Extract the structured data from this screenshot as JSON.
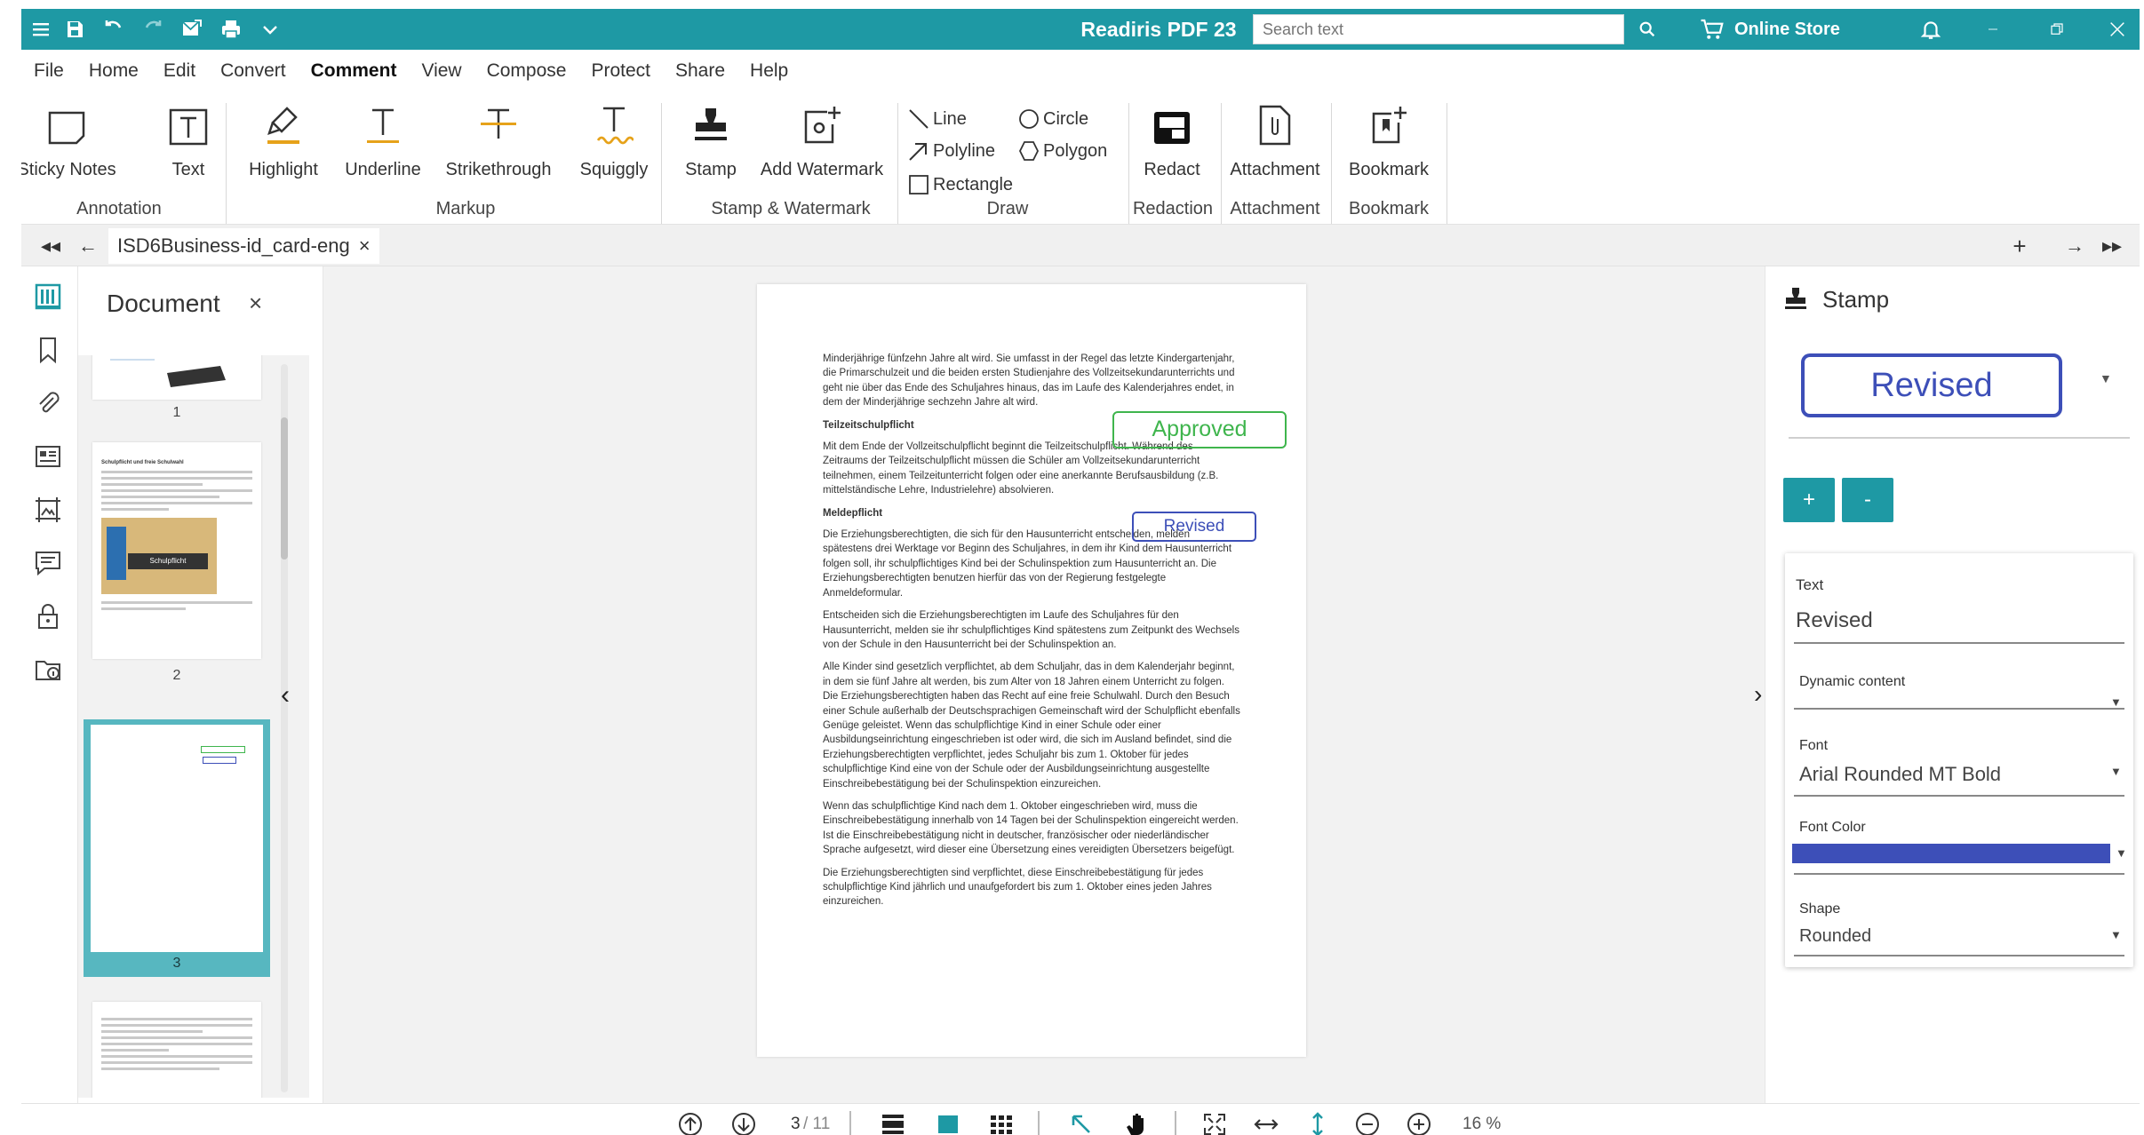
{
  "titlebar": {
    "app_title": "Readiris PDF 23",
    "search_placeholder": "Search text",
    "store_label": "Online Store",
    "accent_color": "#1e99a4"
  },
  "menu": [
    "File",
    "Home",
    "Edit",
    "Convert",
    "Comment",
    "View",
    "Compose",
    "Protect",
    "Share",
    "Help"
  ],
  "menu_active": "Comment",
  "ribbon": {
    "sticky_notes": "Sticky Notes",
    "text": "Text",
    "highlight": "Highlight",
    "underline": "Underline",
    "strikethrough": "Strikethrough",
    "squiggly": "Squiggly",
    "stamp": "Stamp",
    "add_watermark": "Add Watermark",
    "line": "Line",
    "circle": "Circle",
    "polyline": "Polyline",
    "polygon": "Polygon",
    "rectangle": "Rectangle",
    "redact": "Redact",
    "attachment": "Attachment",
    "bookmark": "Bookmark",
    "groups": {
      "annotation": "Annotation",
      "markup": "Markup",
      "stamp_watermark": "Stamp & Watermark",
      "draw": "Draw",
      "redaction": "Redaction",
      "attachment": "Attachment",
      "bookmark": "Bookmark"
    }
  },
  "tab": {
    "label": "ISD6Business-id_card-eng",
    "close": "×"
  },
  "left_panel": {
    "title": "Document",
    "close": "×",
    "thumb_labels": [
      "1",
      "2",
      "3"
    ],
    "thumb2_title": "Schulpflicht und freie Schulwahl",
    "thumb2_image_label": "Schulpflicht"
  },
  "document": {
    "para1": "Minderjährige fünfzehn Jahre alt wird. Sie umfasst in der Regel das letzte Kindergartenjahr, die Primarschulzeit und die beiden ersten Studienjahre des Vollzeitsekundarunterrichts und geht nie über das Ende des Schuljahres hinaus, das im Laufe des Kalenderjahres endet, in dem der Minderjährige sechzehn Jahre alt wird.",
    "heading1": "Teilzeitschulpflicht",
    "para2": "Mit dem Ende der Vollzeitschulpflicht beginnt die Teilzeitschulpflicht. Während des Zeitraums der Teilzeitschulpflicht müssen die Schüler am Vollzeitsekundarunterricht teilnehmen, einem Teilzeitunterricht folgen oder eine anerkannte Berufsausbildung (z.B. mittelständische Lehre, Industrielehre) absolvieren.",
    "heading2": "Meldepflicht",
    "para3": "Die Erziehungsberechtigten, die sich für den Hausunterricht entscheiden, melden spätestens drei Werktage vor Beginn des Schuljahres, in dem ihr Kind dem Hausunterricht folgen soll, ihr schulpflichtiges Kind bei der Schulinspektion zum Hausunterricht an. Die Erziehungsberechtigten benutzen hierfür das von der Regierung festgelegte Anmeldeformular.",
    "para4": "Entscheiden sich die Erziehungsberechtigten im Laufe des Schuljahres für den Hausunterricht, melden sie ihr schulpflichtiges Kind spätestens zum Zeitpunkt des Wechsels von der Schule in den Hausunterricht bei der Schulinspektion an.",
    "para5": "Alle Kinder sind gesetzlich verpflichtet, ab dem Schuljahr, das in dem Kalenderjahr beginnt, in dem sie fünf Jahre alt werden, bis zum Alter von 18 Jahren einem Unterricht zu folgen. Die Erziehungsberechtigten haben das Recht auf eine freie Schulwahl. Durch den Besuch einer Schule außerhalb der Deutschsprachigen Gemeinschaft wird der Schulpflicht ebenfalls Genüge geleistet. Wenn das schulpflichtige Kind in einer Schule oder einer Ausbildungseinrichtung eingeschrieben ist oder wird, die sich im Ausland befindet, sind die Erziehungsberechtigten verpflichtet, jedes Schuljahr bis zum 1. Oktober für jedes schulpflichtige Kind eine von der Schule oder der Ausbildungseinrichtung ausgestellte Einschreibebestätigung bei der Schulinspektion einzureichen.",
    "para6": "Wenn das schulpflichtige Kind nach dem 1. Oktober eingeschrieben wird, muss die Einschreibebestätigung innerhalb von 14 Tagen bei der Schulinspektion eingereicht werden. Ist die Einschreibebestätigung nicht in deutscher, französischer oder niederländischer Sprache aufgesetzt, wird dieser eine Übersetzung eines vereidigten Übersetzers beigefügt.",
    "para7": "Die Erziehungsberechtigten sind verpflichtet, diese Einschreibebestätigung für jedes schulpflichtige Kind jährlich und unaufgefordert bis zum 1. Oktober eines jeden Jahres einzureichen.",
    "stamp_approved": "Approved",
    "stamp_revised": "Revised",
    "approved_color": "#3fb54d",
    "revised_color": "#3d4fb8"
  },
  "right_panel": {
    "title": "Stamp",
    "preview": "Revised",
    "plus": "+",
    "minus": "-",
    "text_label": "Text",
    "text_value": "Revised",
    "dynamic_label": "Dynamic content",
    "font_label": "Font",
    "font_value": "Arial Rounded MT Bold",
    "font_color_label": "Font Color",
    "font_color": "#3d4fb8",
    "shape_label": "Shape",
    "shape_value": "Rounded"
  },
  "bottom": {
    "page_current": "3",
    "page_total": "/ 11",
    "zoom": "16 %"
  }
}
